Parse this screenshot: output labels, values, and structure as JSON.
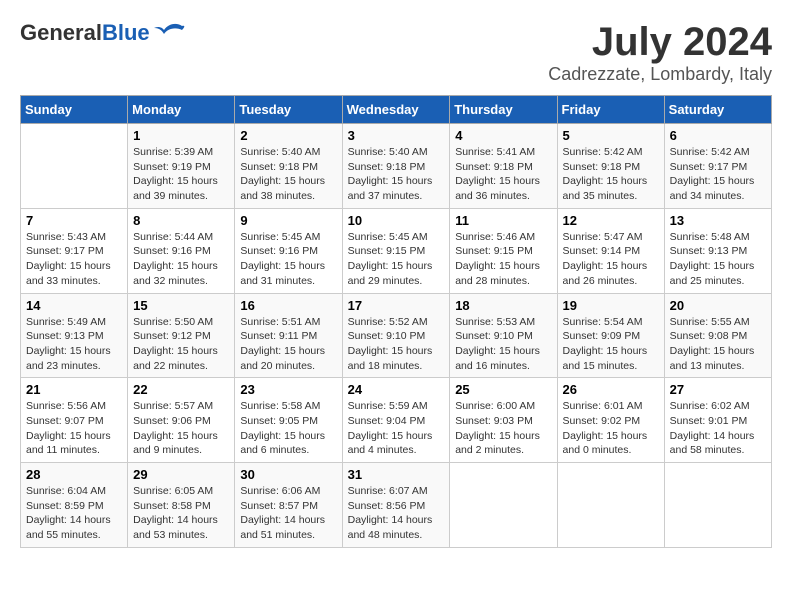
{
  "logo": {
    "line1": "General",
    "line2": "Blue"
  },
  "title": "July 2024",
  "subtitle": "Cadrezzate, Lombardy, Italy",
  "calendar": {
    "headers": [
      "Sunday",
      "Monday",
      "Tuesday",
      "Wednesday",
      "Thursday",
      "Friday",
      "Saturday"
    ],
    "weeks": [
      [
        {
          "day": "",
          "sunrise": "",
          "sunset": "",
          "daylight": ""
        },
        {
          "day": "1",
          "sunrise": "Sunrise: 5:39 AM",
          "sunset": "Sunset: 9:19 PM",
          "daylight": "Daylight: 15 hours and 39 minutes."
        },
        {
          "day": "2",
          "sunrise": "Sunrise: 5:40 AM",
          "sunset": "Sunset: 9:18 PM",
          "daylight": "Daylight: 15 hours and 38 minutes."
        },
        {
          "day": "3",
          "sunrise": "Sunrise: 5:40 AM",
          "sunset": "Sunset: 9:18 PM",
          "daylight": "Daylight: 15 hours and 37 minutes."
        },
        {
          "day": "4",
          "sunrise": "Sunrise: 5:41 AM",
          "sunset": "Sunset: 9:18 PM",
          "daylight": "Daylight: 15 hours and 36 minutes."
        },
        {
          "day": "5",
          "sunrise": "Sunrise: 5:42 AM",
          "sunset": "Sunset: 9:18 PM",
          "daylight": "Daylight: 15 hours and 35 minutes."
        },
        {
          "day": "6",
          "sunrise": "Sunrise: 5:42 AM",
          "sunset": "Sunset: 9:17 PM",
          "daylight": "Daylight: 15 hours and 34 minutes."
        }
      ],
      [
        {
          "day": "7",
          "sunrise": "Sunrise: 5:43 AM",
          "sunset": "Sunset: 9:17 PM",
          "daylight": "Daylight: 15 hours and 33 minutes."
        },
        {
          "day": "8",
          "sunrise": "Sunrise: 5:44 AM",
          "sunset": "Sunset: 9:16 PM",
          "daylight": "Daylight: 15 hours and 32 minutes."
        },
        {
          "day": "9",
          "sunrise": "Sunrise: 5:45 AM",
          "sunset": "Sunset: 9:16 PM",
          "daylight": "Daylight: 15 hours and 31 minutes."
        },
        {
          "day": "10",
          "sunrise": "Sunrise: 5:45 AM",
          "sunset": "Sunset: 9:15 PM",
          "daylight": "Daylight: 15 hours and 29 minutes."
        },
        {
          "day": "11",
          "sunrise": "Sunrise: 5:46 AM",
          "sunset": "Sunset: 9:15 PM",
          "daylight": "Daylight: 15 hours and 28 minutes."
        },
        {
          "day": "12",
          "sunrise": "Sunrise: 5:47 AM",
          "sunset": "Sunset: 9:14 PM",
          "daylight": "Daylight: 15 hours and 26 minutes."
        },
        {
          "day": "13",
          "sunrise": "Sunrise: 5:48 AM",
          "sunset": "Sunset: 9:13 PM",
          "daylight": "Daylight: 15 hours and 25 minutes."
        }
      ],
      [
        {
          "day": "14",
          "sunrise": "Sunrise: 5:49 AM",
          "sunset": "Sunset: 9:13 PM",
          "daylight": "Daylight: 15 hours and 23 minutes."
        },
        {
          "day": "15",
          "sunrise": "Sunrise: 5:50 AM",
          "sunset": "Sunset: 9:12 PM",
          "daylight": "Daylight: 15 hours and 22 minutes."
        },
        {
          "day": "16",
          "sunrise": "Sunrise: 5:51 AM",
          "sunset": "Sunset: 9:11 PM",
          "daylight": "Daylight: 15 hours and 20 minutes."
        },
        {
          "day": "17",
          "sunrise": "Sunrise: 5:52 AM",
          "sunset": "Sunset: 9:10 PM",
          "daylight": "Daylight: 15 hours and 18 minutes."
        },
        {
          "day": "18",
          "sunrise": "Sunrise: 5:53 AM",
          "sunset": "Sunset: 9:10 PM",
          "daylight": "Daylight: 15 hours and 16 minutes."
        },
        {
          "day": "19",
          "sunrise": "Sunrise: 5:54 AM",
          "sunset": "Sunset: 9:09 PM",
          "daylight": "Daylight: 15 hours and 15 minutes."
        },
        {
          "day": "20",
          "sunrise": "Sunrise: 5:55 AM",
          "sunset": "Sunset: 9:08 PM",
          "daylight": "Daylight: 15 hours and 13 minutes."
        }
      ],
      [
        {
          "day": "21",
          "sunrise": "Sunrise: 5:56 AM",
          "sunset": "Sunset: 9:07 PM",
          "daylight": "Daylight: 15 hours and 11 minutes."
        },
        {
          "day": "22",
          "sunrise": "Sunrise: 5:57 AM",
          "sunset": "Sunset: 9:06 PM",
          "daylight": "Daylight: 15 hours and 9 minutes."
        },
        {
          "day": "23",
          "sunrise": "Sunrise: 5:58 AM",
          "sunset": "Sunset: 9:05 PM",
          "daylight": "Daylight: 15 hours and 6 minutes."
        },
        {
          "day": "24",
          "sunrise": "Sunrise: 5:59 AM",
          "sunset": "Sunset: 9:04 PM",
          "daylight": "Daylight: 15 hours and 4 minutes."
        },
        {
          "day": "25",
          "sunrise": "Sunrise: 6:00 AM",
          "sunset": "Sunset: 9:03 PM",
          "daylight": "Daylight: 15 hours and 2 minutes."
        },
        {
          "day": "26",
          "sunrise": "Sunrise: 6:01 AM",
          "sunset": "Sunset: 9:02 PM",
          "daylight": "Daylight: 15 hours and 0 minutes."
        },
        {
          "day": "27",
          "sunrise": "Sunrise: 6:02 AM",
          "sunset": "Sunset: 9:01 PM",
          "daylight": "Daylight: 14 hours and 58 minutes."
        }
      ],
      [
        {
          "day": "28",
          "sunrise": "Sunrise: 6:04 AM",
          "sunset": "Sunset: 8:59 PM",
          "daylight": "Daylight: 14 hours and 55 minutes."
        },
        {
          "day": "29",
          "sunrise": "Sunrise: 6:05 AM",
          "sunset": "Sunset: 8:58 PM",
          "daylight": "Daylight: 14 hours and 53 minutes."
        },
        {
          "day": "30",
          "sunrise": "Sunrise: 6:06 AM",
          "sunset": "Sunset: 8:57 PM",
          "daylight": "Daylight: 14 hours and 51 minutes."
        },
        {
          "day": "31",
          "sunrise": "Sunrise: 6:07 AM",
          "sunset": "Sunset: 8:56 PM",
          "daylight": "Daylight: 14 hours and 48 minutes."
        },
        {
          "day": "",
          "sunrise": "",
          "sunset": "",
          "daylight": ""
        },
        {
          "day": "",
          "sunrise": "",
          "sunset": "",
          "daylight": ""
        },
        {
          "day": "",
          "sunrise": "",
          "sunset": "",
          "daylight": ""
        }
      ]
    ]
  }
}
